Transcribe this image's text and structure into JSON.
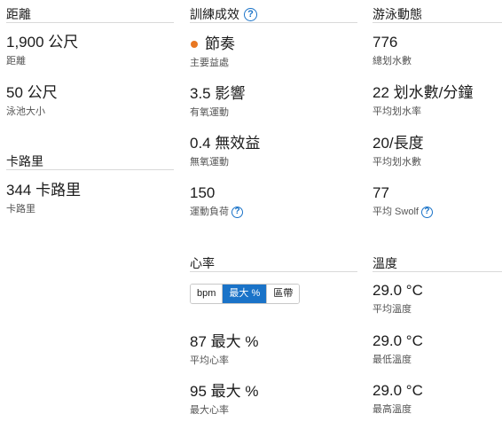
{
  "distance": {
    "heading": "距離",
    "total": {
      "value": "1,900 公尺",
      "label": "距離"
    },
    "pool": {
      "value": "50 公尺",
      "label": "泳池大小"
    }
  },
  "calories": {
    "heading": "卡路里",
    "total": {
      "value": "344 卡路里",
      "label": "卡路里"
    }
  },
  "training": {
    "heading": "訓練成效",
    "primary": {
      "value": "節奏",
      "label": "主要益處",
      "dot_color": "#e87722"
    },
    "aerobic": {
      "value": "3.5 影響",
      "label": "有氧運動"
    },
    "anaerobic": {
      "value": "0.4 無效益",
      "label": "無氧運動"
    },
    "load": {
      "value": "150",
      "label": "運動負荷"
    }
  },
  "heart_rate": {
    "heading": "心率",
    "toggle": [
      "bpm",
      "最大 %",
      "區帶"
    ],
    "active_toggle": "最大 %",
    "avg": {
      "value": "87 最大 %",
      "label": "平均心率"
    },
    "max": {
      "value": "95 最大 %",
      "label": "最大心率"
    }
  },
  "swim": {
    "heading": "游泳動態",
    "strokes": {
      "value": "776",
      "label": "總划水數"
    },
    "rate": {
      "value": "22 划水數/分鐘",
      "label": "平均划水率"
    },
    "per_length": {
      "value": "20/長度",
      "label": "平均划水數"
    },
    "swolf": {
      "value": "77",
      "label": "平均 Swolf"
    }
  },
  "temperature": {
    "heading": "溫度",
    "avg": {
      "value": "29.0 °C",
      "label": "平均溫度"
    },
    "min": {
      "value": "29.0 °C",
      "label": "最低溫度"
    },
    "max": {
      "value": "29.0 °C",
      "label": "最高溫度"
    }
  },
  "colors": {
    "accent": "#1a73c8",
    "dot": "#e87722"
  },
  "icons": {
    "help": "help-circle-icon",
    "dot": "orange-dot-icon"
  }
}
